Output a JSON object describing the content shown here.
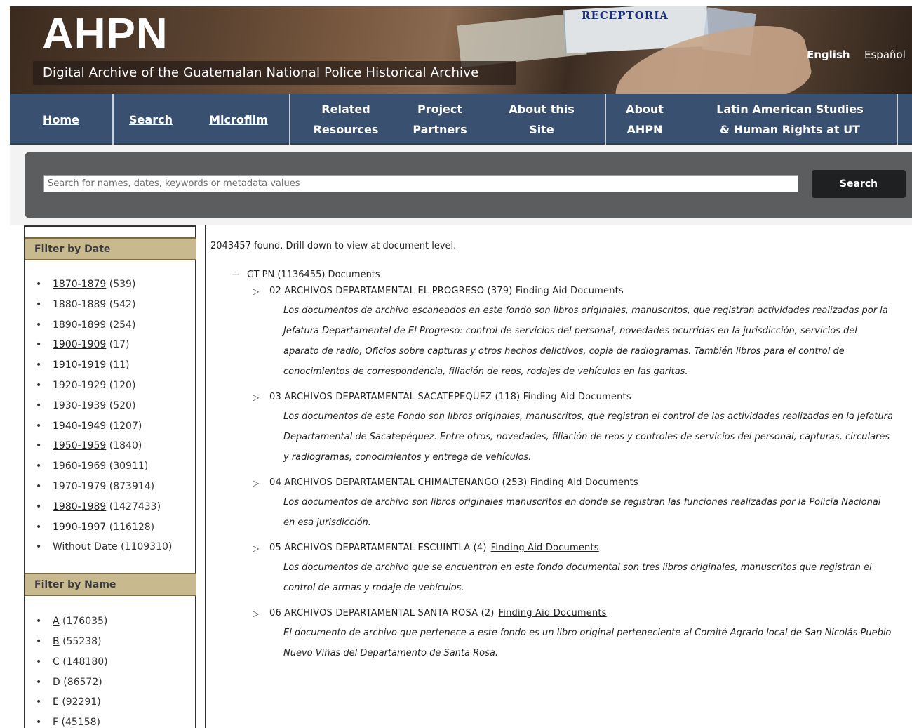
{
  "banner": {
    "logo": "AHPN",
    "subtitle": "Digital Archive of the Guatemalan National Police Historical Archive",
    "photo_text": "RECEPTORIA",
    "languages": [
      "English",
      "Español"
    ]
  },
  "nav": {
    "items": [
      {
        "label": "Home"
      },
      {
        "label": "Search"
      },
      {
        "label": "Microfilm"
      },
      {
        "label": "Related Resources"
      },
      {
        "label": "Project Partners"
      },
      {
        "label": "About this Site"
      },
      {
        "label": "About AHPN"
      },
      {
        "label": "Latin American Studies & Human Rights at UT"
      }
    ]
  },
  "search": {
    "placeholder": "Search for names, dates, keywords or metadata values",
    "button_label": "Search"
  },
  "sidebar": {
    "date_heading": "Filter by Date",
    "dates": [
      {
        "range": "1870-1879",
        "count": "(539)"
      },
      {
        "range": "1880-1889",
        "count": "(542)"
      },
      {
        "range": "1890-1899",
        "count": "(254)"
      },
      {
        "range": "1900-1909",
        "count": "(17)"
      },
      {
        "range": "1910-1919",
        "count": "(11)"
      },
      {
        "range": "1920-1929",
        "count": "(120)"
      },
      {
        "range": "1930-1939",
        "count": "(520)"
      },
      {
        "range": "1940-1949",
        "count": "(1207)"
      },
      {
        "range": "1950-1959",
        "count": "(1840)"
      },
      {
        "range": "1960-1969",
        "count": "(30911)"
      },
      {
        "range": "1970-1979",
        "count": "(873914)"
      },
      {
        "range": "1980-1989",
        "count": "(1427433)"
      },
      {
        "range": "1990-1997",
        "count": "(116128)"
      },
      {
        "range": "Without Date",
        "count": "(1109310)"
      }
    ],
    "name_heading": "Filter by Name",
    "names": [
      {
        "letter": "A",
        "count": "(176035)"
      },
      {
        "letter": "B",
        "count": "(55238)"
      },
      {
        "letter": "C",
        "count": "(148180)"
      },
      {
        "letter": "D",
        "count": "(86572)"
      },
      {
        "letter": "E",
        "count": "(92291)"
      },
      {
        "letter": "F",
        "count": "(45158)"
      }
    ]
  },
  "results": {
    "count_text": "2043457 found. Drill down to view at document level.",
    "root_label": "GT PN (1136455) Documents",
    "root_toggle": "−",
    "nodes": [
      {
        "title": "02 ARCHIVOS DEPARTAMENTAL EL PROGRESO (379) Finding Aid Documents",
        "finding_aid": "",
        "desc": "Los documentos de archivo escaneados en este fondo son libros originales, manuscritos, que registran actividades realizadas por la Jefatura Departamental de El Progreso: control de servicios del personal, novedades ocurridas en la jurisdicción, servicios del aparato de radio, Oficios sobre capturas y otros hechos delictivos, copia de radiogramas. También libros para el control de conocimientos de correspondencia, filiación de reos, rodajes de vehículos en las garitas."
      },
      {
        "title": "03 ARCHIVOS DEPARTAMENTAL SACATEPEQUEZ (118) Finding Aid Documents",
        "finding_aid": "",
        "desc": "Los documentos de este Fondo son libros originales, manuscritos, que registran el control de las actividades realizadas en la Jefatura Departamental de Sacatepéquez. Entre otros, novedades, filiación de reos y controles de servicios del personal, capturas, circulares y radiogramas, conocimientos y entrega de vehículos."
      },
      {
        "title": "04 ARCHIVOS DEPARTAMENTAL CHIMALTENANGO (253) Finding Aid Documents",
        "finding_aid": "",
        "desc": "Los documentos de archivo son libros originales manuscritos en donde se registran las funciones realizadas por la Policía Nacional en esa jurisdicción."
      },
      {
        "title": "05 ARCHIVOS DEPARTAMENTAL ESCUINTLA (4)",
        "finding_aid": "Finding Aid Documents",
        "desc": "Los documentos de archivo que se encuentran en este fondo documental son tres libros originales, manuscritos que registran el control de armas y rodaje de vehículos."
      },
      {
        "title": "06 ARCHIVOS DEPARTAMENTAL SANTA ROSA (2)",
        "finding_aid": "Finding Aid Documents",
        "desc": "El documento de archivo que pertenece a este fondo es un libro original perteneciente al Comité Agrario local de San Nicolás Pueblo Nuevo Viñas del Departamento de Santa Rosa."
      }
    ]
  }
}
